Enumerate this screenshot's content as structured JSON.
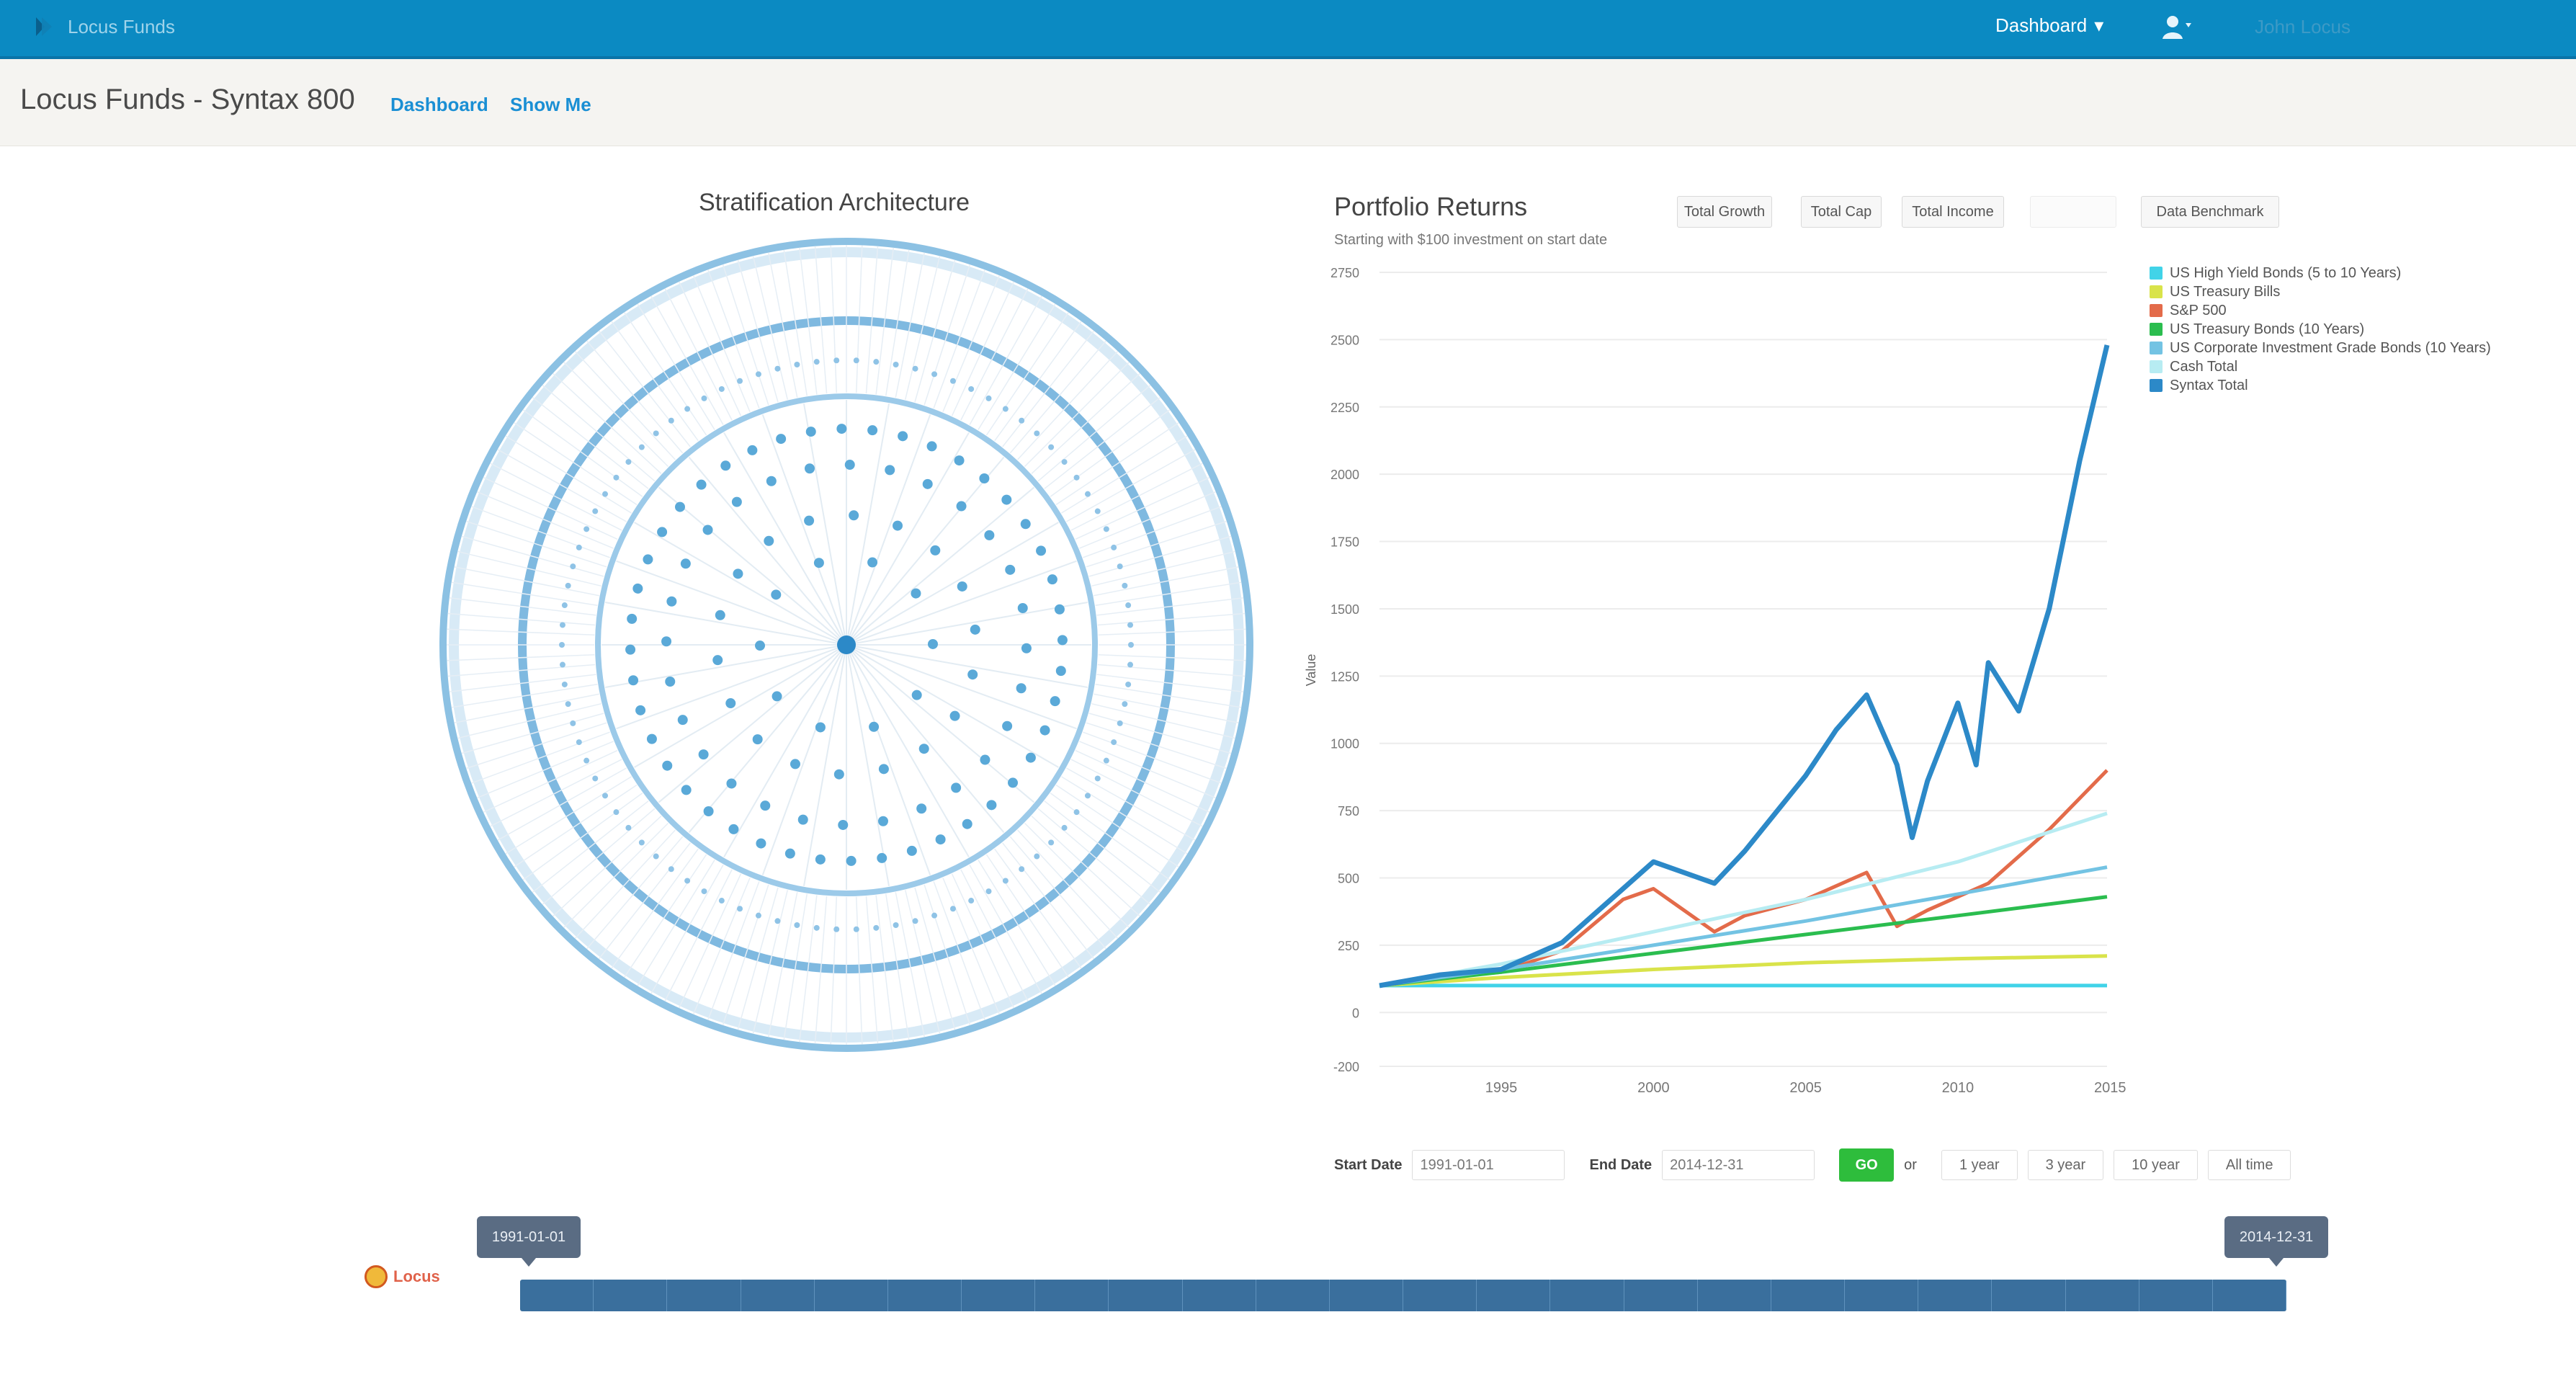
{
  "app": {
    "brand": "Locus Funds",
    "dashboard_menu": "Dashboard",
    "user_name": "John Locus"
  },
  "page": {
    "title": "Locus Funds - Syntax 800",
    "links": [
      "Dashboard",
      "Show Me"
    ]
  },
  "stratification": {
    "title": "Stratification Architecture"
  },
  "chart_panel": {
    "title": "Portfolio Returns",
    "subtitle": "Starting with $100 investment on start date",
    "buttons": [
      "Total Growth",
      "Total Cap",
      "Total Income",
      "",
      "Data Benchmark"
    ]
  },
  "filters": {
    "start_label": "Start Date",
    "start_value": "1991-01-01",
    "end_label": "End Date",
    "end_value": "2014-12-31",
    "go_label": "GO",
    "or_label": "or",
    "quick_ranges": [
      "1 year",
      "3 year",
      "10 year",
      "All time"
    ]
  },
  "timeline": {
    "logo_text": "Locus",
    "start_handle": "1991-01-01",
    "end_handle": "2014-12-31"
  },
  "chart_data": {
    "type": "line",
    "ylabel": "Value",
    "ylim": [
      -200,
      2750
    ],
    "yticks": [
      -200,
      0,
      250,
      500,
      750,
      1000,
      1250,
      1500,
      1750,
      2000,
      2250,
      2500,
      2750
    ],
    "xlim": [
      1991,
      2014.9
    ],
    "xticks": [
      1995,
      2000,
      2005,
      2010,
      2015
    ],
    "legend_position": "right",
    "series": [
      {
        "name": "US High Yield Bonds (5 to 10 Years)",
        "color": "#41d3e8",
        "x": [
          1991,
          1995,
          2000,
          2005,
          2010,
          2014.9
        ],
        "y": [
          100,
          100,
          100,
          100,
          100,
          100
        ]
      },
      {
        "name": "US Treasury Bills",
        "color": "#d9e34a",
        "x": [
          1991,
          1995,
          2000,
          2005,
          2010,
          2014.9
        ],
        "y": [
          100,
          130,
          160,
          185,
          200,
          210
        ]
      },
      {
        "name": "S&P 500",
        "color": "#e36b4a",
        "x": [
          1991,
          1993,
          1995,
          1997,
          1999,
          2000,
          2001,
          2002,
          2003,
          2005,
          2007,
          2008,
          2009,
          2011,
          2013,
          2014.9
        ],
        "y": [
          100,
          130,
          150,
          230,
          420,
          460,
          380,
          300,
          360,
          420,
          520,
          320,
          380,
          480,
          680,
          900
        ]
      },
      {
        "name": "US Treasury Bonds (10 Years)",
        "color": "#2bbd4f",
        "x": [
          1991,
          1995,
          2000,
          2005,
          2010,
          2014.9
        ],
        "y": [
          100,
          150,
          220,
          290,
          360,
          430
        ]
      },
      {
        "name": "US Corporate Investment Grade Bonds (10 Years)",
        "color": "#73c3e3",
        "x": [
          1991,
          1995,
          2000,
          2005,
          2010,
          2014.9
        ],
        "y": [
          100,
          160,
          250,
          340,
          440,
          540
        ]
      },
      {
        "name": "Cash Total",
        "color": "#b7ecf2",
        "x": [
          1991,
          1995,
          2000,
          2005,
          2010,
          2014.9
        ],
        "y": [
          100,
          180,
          300,
          420,
          560,
          740
        ]
      },
      {
        "name": "Syntax Total",
        "color": "#2c89c8",
        "x": [
          1991,
          1993,
          1995,
          1997,
          1999,
          2000,
          2001,
          2002,
          2003,
          2005,
          2006,
          2007,
          2008,
          2008.5,
          2009,
          2010,
          2010.6,
          2011,
          2012,
          2013,
          2014,
          2014.9
        ],
        "y": [
          100,
          140,
          160,
          260,
          460,
          560,
          520,
          480,
          600,
          880,
          1050,
          1180,
          920,
          650,
          860,
          1150,
          920,
          1300,
          1120,
          1500,
          2050,
          2480
        ]
      }
    ]
  }
}
